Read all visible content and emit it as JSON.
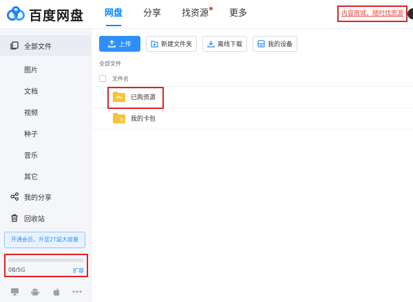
{
  "header": {
    "logo_text": "百度网盘",
    "nav": [
      {
        "label": "网盘",
        "active": true
      },
      {
        "label": "分享",
        "active": false
      },
      {
        "label": "找资源",
        "active": false,
        "badge": true
      },
      {
        "label": "更多",
        "active": false
      }
    ],
    "promo_link": "内容商城，随时找资源"
  },
  "sidebar": {
    "all_files": "全部文件",
    "categories": [
      "图片",
      "文档",
      "视频",
      "种子",
      "音乐",
      "其它"
    ],
    "my_share": "我的分享",
    "recycle_bin": "回收站",
    "vip_button": "开通会员，升至2T超大容量",
    "storage": {
      "used_text": "0B/5G",
      "expand_label": "扩容",
      "used_fraction": 0.0
    },
    "devices": [
      "monitor-icon",
      "android-icon",
      "apple-icon",
      "more-icon"
    ]
  },
  "toolbar": {
    "upload": "上传",
    "new_folder": "新建文件夹",
    "offline_download": "离线下载",
    "my_devices": "我的设备"
  },
  "breadcrumb": "全部文件",
  "file_list": {
    "column_name": "文件名",
    "rows": [
      {
        "name": "已购资源",
        "icon": "purchased-folder-icon"
      },
      {
        "name": "我的卡包",
        "icon": "folder-icon"
      }
    ]
  },
  "colors": {
    "accent": "#2f8ff8",
    "highlight_box": "#e02020",
    "folder": "#f7c23a"
  }
}
